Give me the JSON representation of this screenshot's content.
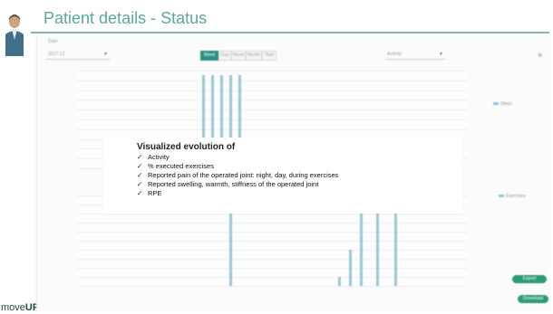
{
  "header": {
    "title": "Patient details - Status"
  },
  "brand": {
    "prefix": "move",
    "suffix": "UP"
  },
  "app": {
    "period_label": "Date",
    "period_value": "2017-12",
    "range_buttons": [
      "Week",
      "Day",
      "Week",
      "Month",
      "Year"
    ],
    "range_active": 0,
    "metric_dropdown": "Activity",
    "chart_top_legend": "Steps",
    "chart_bottom_legend": "Exercises",
    "buttons": {
      "export": "Export",
      "download": "Download"
    }
  },
  "chart_data": [
    {
      "type": "bar",
      "series": [
        {
          "values": [
            95,
            95,
            95,
            95,
            95,
            20,
            10,
            10,
            10,
            10
          ]
        }
      ]
    },
    {
      "type": "bar",
      "series": [
        {
          "values": [
            100,
            10,
            40,
            100,
            100,
            100
          ]
        }
      ]
    }
  ],
  "overlay": {
    "title": "Visualized evolution of",
    "check_glyph": "✓",
    "items": [
      "Activity",
      "% executed exercises",
      "Reported pain of the operated joint: night, day, during exercises",
      "Reported swelling, warmth, stiffness of the operated joint",
      "RPE"
    ]
  },
  "colors": {
    "accent": "#5ea89b",
    "bar": "#98c7d6",
    "brand_dark": "#1f4a3f",
    "button": "#2e9a76"
  }
}
